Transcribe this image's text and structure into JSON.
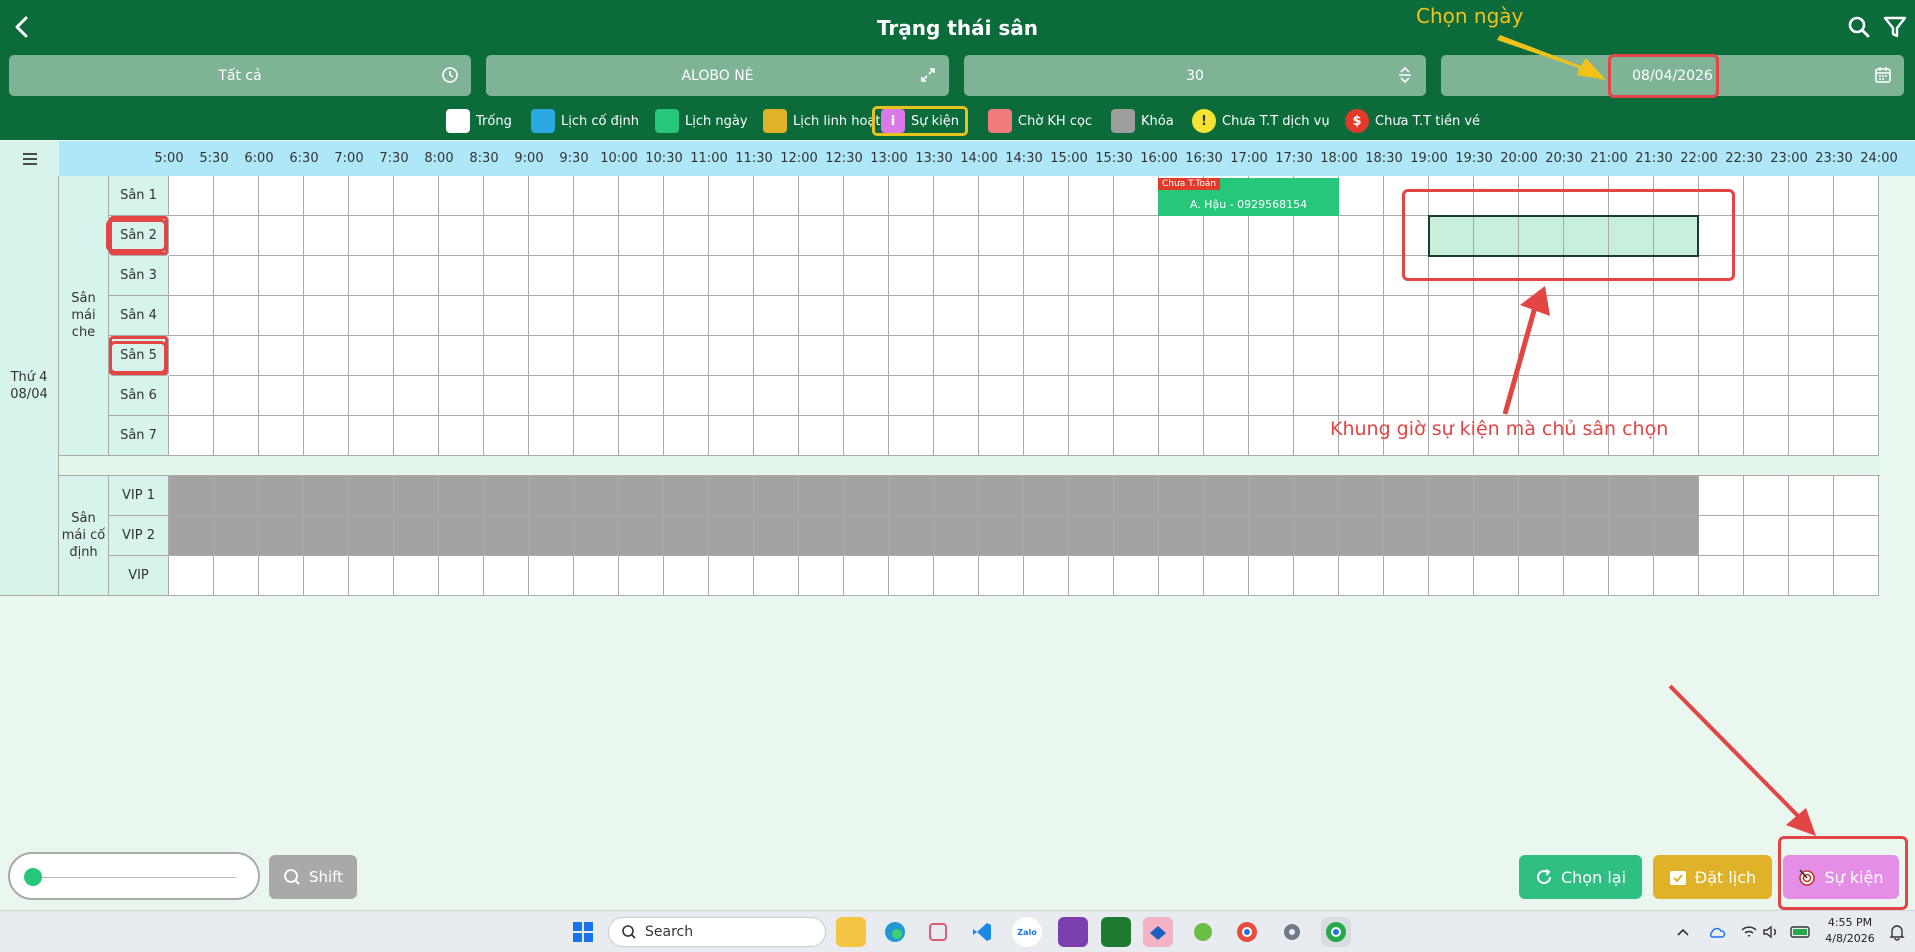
{
  "header": {
    "title": "Trạng thái sân",
    "filters": {
      "all": "Tất cả",
      "venue": "ALOBO NÈ",
      "duration": "30",
      "date": "08/04/2026"
    }
  },
  "legend": [
    {
      "label": "Trống",
      "color": "#ffffff",
      "symbol": ""
    },
    {
      "label": "Lịch cố định",
      "color": "#2aa8e0",
      "symbol": ""
    },
    {
      "label": "Lịch ngày",
      "color": "#27c77b",
      "symbol": ""
    },
    {
      "label": "Lịch linh hoạt",
      "color": "#e0b22a",
      "symbol": ""
    },
    {
      "label": "Sự kiện",
      "color": "#d97ae8",
      "symbol": "i"
    },
    {
      "label": "Chờ KH cọc",
      "color": "#f07a7a",
      "symbol": ""
    },
    {
      "label": "Khóa",
      "color": "#9e9e9e",
      "symbol": ""
    },
    {
      "label": "Chưa T.T dịch vụ",
      "color": "#f5e431",
      "symbol": "!"
    },
    {
      "label": "Chưa T.T tiền vé",
      "color": "#e23a2a",
      "symbol": "$"
    }
  ],
  "times": [
    "5:00",
    "5:30",
    "6:00",
    "6:30",
    "7:00",
    "7:30",
    "8:00",
    "8:30",
    "9:00",
    "9:30",
    "10:00",
    "10:30",
    "11:00",
    "11:30",
    "12:00",
    "12:30",
    "13:00",
    "13:30",
    "14:00",
    "14:30",
    "15:00",
    "15:30",
    "16:00",
    "16:30",
    "17:00",
    "17:30",
    "18:00",
    "18:30",
    "19:00",
    "19:30",
    "20:00",
    "20:30",
    "21:00",
    "21:30",
    "22:00",
    "22:30",
    "23:00",
    "23:30",
    "24:00"
  ],
  "day": {
    "weekday": "Thứ 4",
    "date": "08/04"
  },
  "groups": [
    {
      "name": "Sân mái che",
      "courts": [
        "Sân 1",
        "Sân 2",
        "Sân 3",
        "Sân 4",
        "Sân 5",
        "Sân 6",
        "Sân 7"
      ]
    },
    {
      "name": "Sân mái cố định",
      "courts": [
        "VIP 1",
        "VIP 2",
        "VIP"
      ]
    }
  ],
  "booking": {
    "tag": "Chưa T.Toán",
    "label": "A. Hậu - 0929568154"
  },
  "annotations": {
    "choose_date": "Chọn ngày",
    "event_slot": "Khung giờ sự kiện mà chủ sân chọn"
  },
  "bottom": {
    "shift": "Shift",
    "reset": "Chọn lại",
    "book": "Đặt lịch",
    "event": "Sự kiện"
  },
  "taskbar": {
    "search_placeholder": "Search",
    "time": "4:55 PM",
    "date": "4/8/2026"
  },
  "colors": {
    "header": "#0b6b3a",
    "booking": "#27c77b",
    "locked": "#a3a3a3",
    "selected": "#c8eedc",
    "reset_button": "#2fbf83",
    "book_button": "#e0b22a",
    "event_button": "#e58ee8",
    "annotation_red": "#e34444",
    "annotation_yellow": "#f2c21b"
  }
}
